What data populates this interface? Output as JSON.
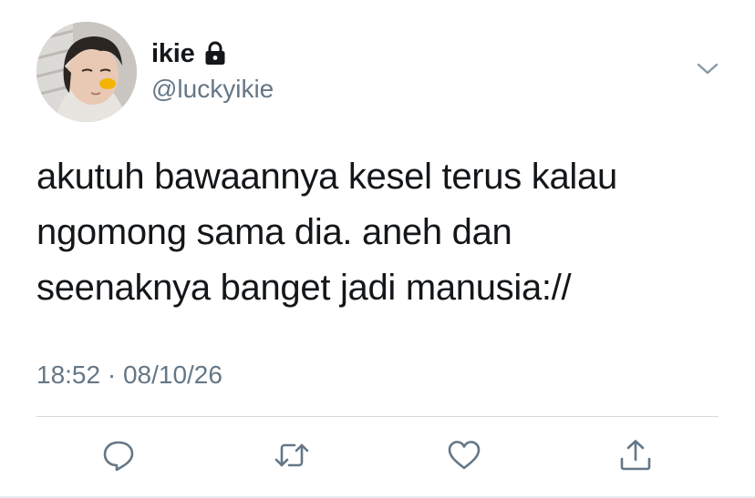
{
  "author": {
    "display_name": "ikie",
    "handle": "@luckyikie",
    "protected_icon": "lock-icon",
    "avatar_icon": "profile-photo"
  },
  "tweet": {
    "text": "akutuh bawaannya kesel terus kalau\nngomong sama dia. aneh dan\nseenaknya banget jadi manusia://",
    "timestamp": "18:52 · 08/10/26"
  },
  "menu": {
    "icon": "chevron-down-icon"
  },
  "actions": [
    {
      "name": "reply",
      "icon": "speech-bubble-icon"
    },
    {
      "name": "retweet",
      "icon": "retweet-arrows-icon"
    },
    {
      "name": "like",
      "icon": "heart-icon"
    },
    {
      "name": "share",
      "icon": "share-upload-icon"
    }
  ],
  "colors": {
    "text_primary": "#14171a",
    "text_secondary": "#657786",
    "icon_gray": "#657786",
    "divider": "#d4d9dd"
  }
}
